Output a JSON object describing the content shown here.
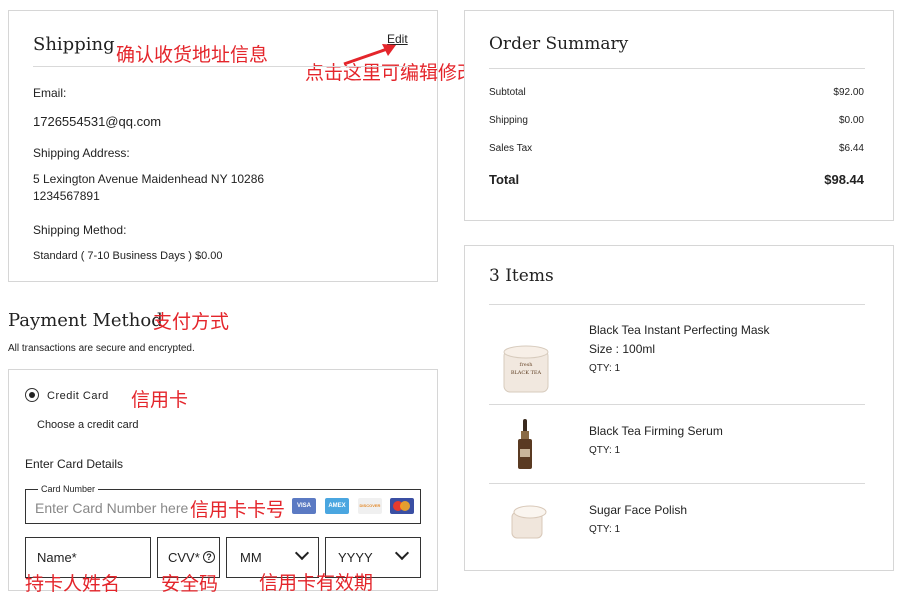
{
  "shipping": {
    "title": "Shipping",
    "edit_label": "Edit",
    "annotation_confirm": "确认收货地址信息",
    "annotation_edit": "点击这里可编辑修改地址",
    "email_label": "Email:",
    "email_value": "1726554531@qq.com",
    "address_label": "Shipping Address:",
    "address_line": "5 Lexington Avenue Maidenhead NY 10286",
    "phone": "1234567891",
    "method_label": "Shipping Method:",
    "method_value": "Standard ( 7-10 Business Days ) $0.00"
  },
  "payment": {
    "title": "Payment Method",
    "annotation_title": "支付方式",
    "secure_note": "All transactions are secure and encrypted.",
    "credit_card_label": "Credit Card",
    "annotation_credit": "信用卡",
    "choose_text": "Choose a credit card",
    "enter_details": "Enter Card Details",
    "card_number_label": "Card Number",
    "card_number_placeholder": "Enter Card Number here",
    "annotation_card_number": "信用卡卡号",
    "card_logos": [
      "VISA",
      "AMEX",
      "DISCOVER",
      "MASTERCARD"
    ],
    "name_placeholder": "Name*",
    "cvv_placeholder": "CVV*",
    "mm_placeholder": "MM",
    "yyyy_placeholder": "YYYY",
    "annotation_name": "持卡人姓名",
    "annotation_cvv": "安全码",
    "annotation_expiry": "信用卡有效期"
  },
  "summary": {
    "title": "Order Summary",
    "rows": [
      {
        "label": "Subtotal",
        "value": "$92.00"
      },
      {
        "label": "Shipping",
        "value": "$0.00"
      },
      {
        "label": "Sales Tax",
        "value": "$6.44"
      }
    ],
    "total_label": "Total",
    "total_value": "$98.44"
  },
  "items": {
    "title": "3 Items",
    "list": [
      {
        "name": "Black Tea Instant Perfecting Mask",
        "size": "Size : 100ml",
        "qty": "QTY: 1"
      },
      {
        "name": "Black Tea Firming Serum",
        "qty": "QTY: 1"
      },
      {
        "name": "Sugar Face Polish",
        "qty": "QTY: 1"
      }
    ]
  },
  "colors": {
    "annotation": "#e4252b",
    "border": "#d6d6d6"
  }
}
